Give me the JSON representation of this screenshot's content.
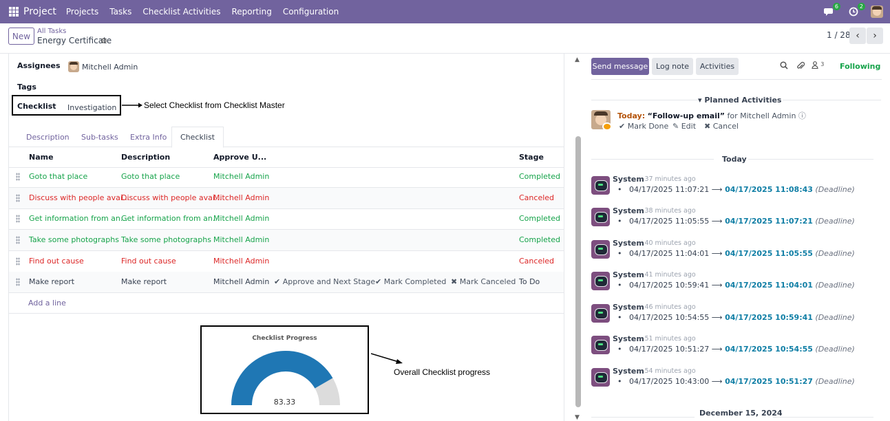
{
  "navbar": {
    "app_name": "Project",
    "menu": [
      "Projects",
      "Tasks",
      "Checklist Activities",
      "Reporting",
      "Configuration"
    ],
    "messages_badge": "6",
    "activities_badge": "2"
  },
  "control_panel": {
    "new_label": "New",
    "breadcrumb_parent": "All Tasks",
    "breadcrumb_current": "Energy Certificate",
    "pager": "1 / 28"
  },
  "form": {
    "assignees_label": "Assignees",
    "assignee": "Mitchell Admin",
    "tags_label": "Tags",
    "checklist_label": "Checklist",
    "checklist_value": "Investigation",
    "annotation_checklist": "Select Checklist from Checklist Master",
    "annotation_progress": "Overall Checklist progress",
    "tabs": [
      "Description",
      "Sub-tasks",
      "Extra Info",
      "Checklist"
    ],
    "active_tab": "Checklist"
  },
  "checklist_table": {
    "headers": [
      "Name",
      "Description",
      "Approve U...",
      "Stage"
    ],
    "rows": [
      {
        "name": "Goto that place",
        "description": "Goto that place",
        "user": "Mitchell Admin",
        "stage": "Completed",
        "status": "completed"
      },
      {
        "name": "Discuss with people avai...",
        "description": "Discuss with people avai...",
        "user": "Mitchell Admin",
        "stage": "Canceled",
        "status": "canceled"
      },
      {
        "name": "Get information from an...",
        "description": "Get information from an...",
        "user": "Mitchell Admin",
        "stage": "Completed",
        "status": "completed"
      },
      {
        "name": "Take some photographs",
        "description": "Take some photographs",
        "user": "Mitchell Admin",
        "stage": "Completed",
        "status": "completed"
      },
      {
        "name": "Find out cause",
        "description": "Find out cause",
        "user": "Mitchell Admin",
        "stage": "Canceled",
        "status": "canceled"
      },
      {
        "name": "Make report",
        "description": "Make report",
        "user": "Mitchell Admin",
        "stage": "To Do",
        "status": "todo"
      }
    ],
    "row_actions": [
      "Approve and Next Stage",
      "Mark Completed",
      "Mark Canceled"
    ],
    "add_line": "Add a line"
  },
  "gauge": {
    "title": "Checklist Progress",
    "value_label": "83.33",
    "value": 83.33,
    "max": 100,
    "fill_color": "#1f77b4",
    "track_color": "#dcdcdc"
  },
  "chatter": {
    "send_message": "Send message",
    "log_note": "Log note",
    "activities": "Activities",
    "followers_count": "3",
    "following": "Following",
    "planned_title": "Planned Activities",
    "planned": {
      "today_label": "Today:",
      "summary": "“Follow-up email”",
      "for": "for Mitchell Admin",
      "mark_done": "Mark Done",
      "edit": "Edit",
      "cancel": "Cancel"
    },
    "today_sep": "Today",
    "messages": [
      {
        "author": "System",
        "time": "- 37 minutes ago",
        "old": "04/17/2025 11:07:21",
        "new": "04/17/2025 11:08:43",
        "field": "(Deadline)"
      },
      {
        "author": "System",
        "time": "- 38 minutes ago",
        "old": "04/17/2025 11:05:55",
        "new": "04/17/2025 11:07:21",
        "field": "(Deadline)"
      },
      {
        "author": "System",
        "time": "- 40 minutes ago",
        "old": "04/17/2025 11:04:01",
        "new": "04/17/2025 11:05:55",
        "field": "(Deadline)"
      },
      {
        "author": "System",
        "time": "- 41 minutes ago",
        "old": "04/17/2025 10:59:41",
        "new": "04/17/2025 11:04:01",
        "field": "(Deadline)"
      },
      {
        "author": "System",
        "time": "- 46 minutes ago",
        "old": "04/17/2025 10:54:55",
        "new": "04/17/2025 10:59:41",
        "field": "(Deadline)"
      },
      {
        "author": "System",
        "time": "- 51 minutes ago",
        "old": "04/17/2025 10:51:27",
        "new": "04/17/2025 10:54:55",
        "field": "(Deadline)"
      },
      {
        "author": "System",
        "time": "- 54 minutes ago",
        "old": "04/17/2025 10:43:00",
        "new": "04/17/2025 10:51:27",
        "field": "(Deadline)"
      }
    ],
    "older_sep": "December 15, 2024"
  }
}
